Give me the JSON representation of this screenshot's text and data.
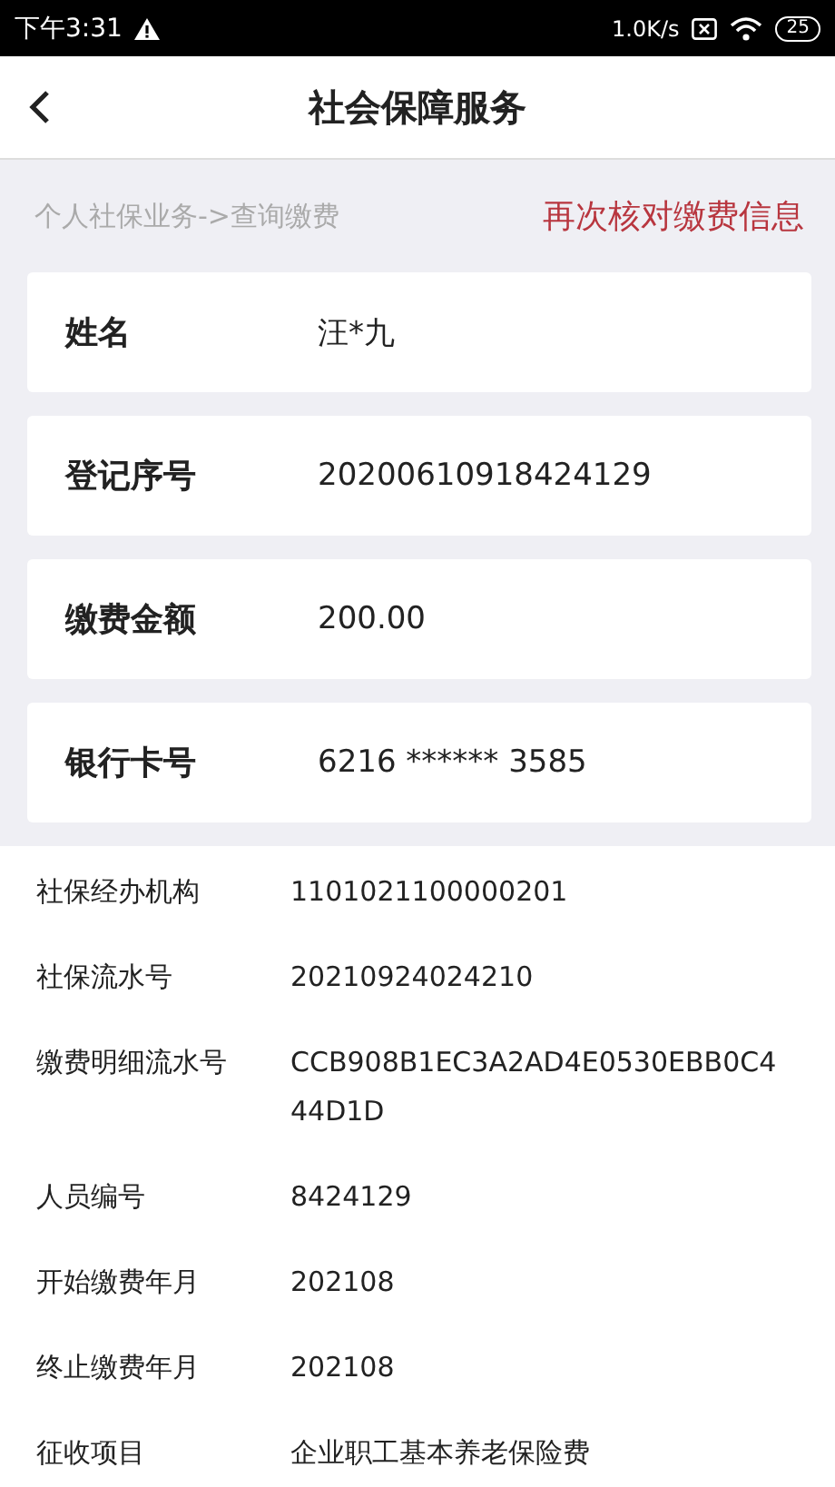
{
  "status_bar": {
    "time": "下午3:31",
    "speed": "1.0K/s",
    "battery": "25"
  },
  "header": {
    "title": "社会保障服务"
  },
  "breadcrumb": "个人社保业务->查询缴费",
  "annotation": "再次核对缴费信息",
  "cards": [
    {
      "label": "姓名",
      "value": "汪*九"
    },
    {
      "label": "登记序号",
      "value": "20200610918424129"
    },
    {
      "label": "缴费金额",
      "value": "200.00"
    },
    {
      "label": "银行卡号",
      "value": "6216 ****** 3585"
    }
  ],
  "details": [
    {
      "label": "社保经办机构",
      "value": "1101021100000201"
    },
    {
      "label": "社保流水号",
      "value": "20210924024210"
    },
    {
      "label": "缴费明细流水号",
      "value": "CCB908B1EC3A2AD4E0530EBB0C444D1D"
    },
    {
      "label": "人员编号",
      "value": "8424129"
    },
    {
      "label": "开始缴费年月",
      "value": "202108"
    },
    {
      "label": "终止缴费年月",
      "value": "202108"
    },
    {
      "label": "征收项目",
      "value": "企业职工基本养老保险费"
    }
  ]
}
